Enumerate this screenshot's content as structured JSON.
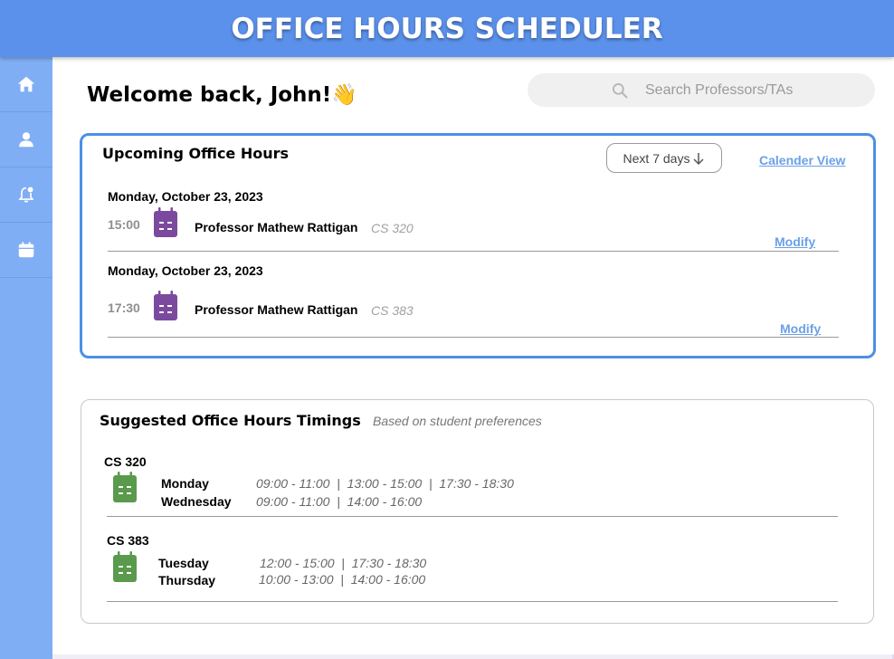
{
  "header": {
    "title": "OFFICE HOURS SCHEDULER"
  },
  "sidebar": {
    "items": [
      {
        "icon": "home-icon"
      },
      {
        "icon": "user-icon"
      },
      {
        "icon": "notification-bell-icon"
      },
      {
        "icon": "calendar-icon"
      }
    ]
  },
  "welcome": {
    "text": "Welcome back, John!👋"
  },
  "search": {
    "placeholder": "Search Professors/TAs"
  },
  "upcoming": {
    "title": "Upcoming Office Hours",
    "range_label": "Next 7 days",
    "calendar_link": "Calender View",
    "entries": [
      {
        "date": "Monday, October 23, 2023",
        "time": "15:00",
        "professor": "Professor Mathew Rattigan",
        "course": "CS 320",
        "action": "Modify"
      },
      {
        "date": "Monday, October 23, 2023",
        "time": "17:30",
        "professor": "Professor Mathew Rattigan",
        "course": "CS 383",
        "action": "Modify"
      }
    ]
  },
  "suggested": {
    "title": "Suggested Office Hours Timings",
    "subtitle": "Based on student preferences",
    "courses": [
      {
        "course": "CS 320",
        "rows": [
          {
            "day": "Monday",
            "slots": "09:00 - 11:00  |  13:00 - 15:00  |  17:30 - 18:30"
          },
          {
            "day": "Wednesday",
            "slots": "09:00 - 11:00  |  14:00 - 16:00"
          }
        ]
      },
      {
        "course": "CS 383",
        "rows": [
          {
            "day": "Tuesday",
            "slots": "12:00 - 15:00  |  17:30 - 18:30"
          },
          {
            "day": "Thursday",
            "slots": "10:00 - 13:00  |  14:00 - 16:00"
          }
        ]
      }
    ]
  },
  "colors": {
    "header": "#5b91ea",
    "sidebar": "#80aef4",
    "card_border": "#4a90e6",
    "event_calendar": "#7b4a9e",
    "suggest_calendar": "#5a9a4c",
    "link": "#6aa0e8"
  }
}
